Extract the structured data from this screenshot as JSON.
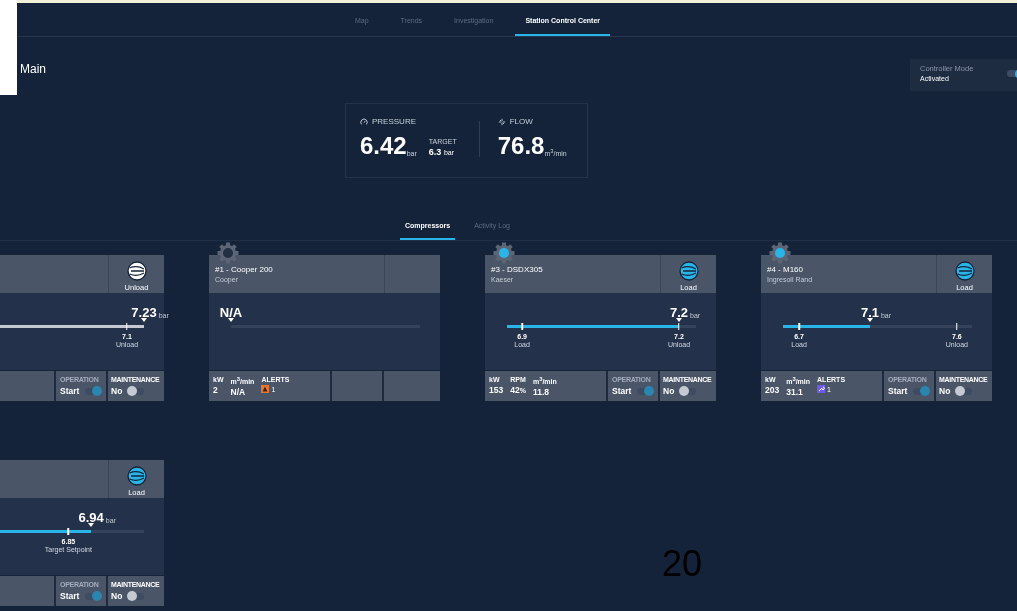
{
  "nav": {
    "tabs": [
      {
        "label": "Map",
        "selected": false
      },
      {
        "label": "Trends",
        "selected": false
      },
      {
        "label": "Investigation",
        "selected": false
      },
      {
        "label": "Station Control Center",
        "selected": true
      }
    ]
  },
  "page_title": "Main",
  "controller": {
    "label": "Controller Mode",
    "status": "Activated",
    "on": true
  },
  "summary": {
    "pressure": {
      "label": "PRESSURE",
      "value": "6.42",
      "unit": "bar",
      "target_label": "TARGET",
      "target_value": "6.3",
      "target_unit": "bar"
    },
    "flow": {
      "label": "FLOW",
      "value": "76.8",
      "unit": "m$^{3}$/min"
    }
  },
  "subtabs": [
    {
      "label": "Compressors",
      "selected": true
    },
    {
      "label": "Activity Log",
      "selected": false
    }
  ],
  "compressors": [
    {
      "kind": "unload",
      "status": "Unload",
      "value": "7.23",
      "unit": "bar",
      "level": 1,
      "ticks": [
        {
          "value": "7.1",
          "label": "Unload",
          "level": 0.91
        }
      ],
      "operation": {
        "label": "OPERATION",
        "value": "Start",
        "on": true,
        "disabled": true
      },
      "maintenance": {
        "label": "MAINTENANCE",
        "value": "No",
        "on": false
      }
    },
    {
      "kind": "idle",
      "gear": true,
      "title": "#1 - Cooper 200",
      "subtitle": "Cooper",
      "value": "N/A",
      "level": 0,
      "stats": [
        {
          "kind": "number",
          "label": "kW",
          "value": "2"
        },
        {
          "kind": "number",
          "label": "m$^{3}$/min",
          "value": "N/A"
        },
        {
          "kind": "warning",
          "label": "ALERTS",
          "value": "1"
        }
      ]
    },
    {
      "kind": "load",
      "gear": true,
      "title": "#3 - DSDX305",
      "subtitle": "Kaeser",
      "status": "Load",
      "value": "7.2",
      "unit": "bar",
      "level": 0.91,
      "ticks": [
        {
          "value": "6.9",
          "label": "Load",
          "level": 0.08
        },
        {
          "value": "7.2",
          "label": "Unload",
          "level": 0.91
        }
      ],
      "stats": [
        {
          "kind": "number",
          "label": "kW",
          "value": "153"
        },
        {
          "kind": "number",
          "label": "RPM",
          "value": "42",
          "unit": "%"
        },
        {
          "kind": "number",
          "label": "m$^{3}$/min",
          "value": "11.8"
        }
      ],
      "operation": {
        "label": "OPERATION",
        "value": "Start",
        "on": true,
        "disabled": true
      },
      "maintenance": {
        "label": "MAINTENANCE",
        "value": "No",
        "on": false
      }
    },
    {
      "kind": "load",
      "gear": true,
      "title": "#4 - M160",
      "subtitle": "Ingresoll Rand",
      "status": "Load",
      "value": "7.1",
      "unit": "bar",
      "level": 0.46,
      "ticks": [
        {
          "value": "6.7",
          "label": "Load",
          "level": 0.085
        },
        {
          "value": "7.6",
          "label": "Unload",
          "level": 0.92
        }
      ],
      "stats": [
        {
          "kind": "number",
          "label": "kW",
          "value": "203"
        },
        {
          "kind": "number",
          "label": "m$^{3}$/min",
          "value": "31.1"
        },
        {
          "kind": "wrench",
          "label": "ALERTS",
          "value": "1"
        }
      ],
      "operation": {
        "label": "OPERATION",
        "value": "Start",
        "on": true,
        "disabled": true
      },
      "maintenance": {
        "label": "MAINTENANCE",
        "value": "No",
        "on": false
      }
    },
    {
      "kind": "load",
      "status": "Load",
      "value": "6.94",
      "unit": "bar",
      "level": 0.72,
      "ticks": [
        {
          "value": "6.85",
          "label": "Target Setpoint",
          "level": 0.6
        }
      ],
      "operation": {
        "label": "OPERATION",
        "value": "Start",
        "on": true,
        "disabled": true
      },
      "maintenance": {
        "label": "MAINTENANCE",
        "value": "No",
        "on": false
      }
    }
  ],
  "page_number": "20"
}
